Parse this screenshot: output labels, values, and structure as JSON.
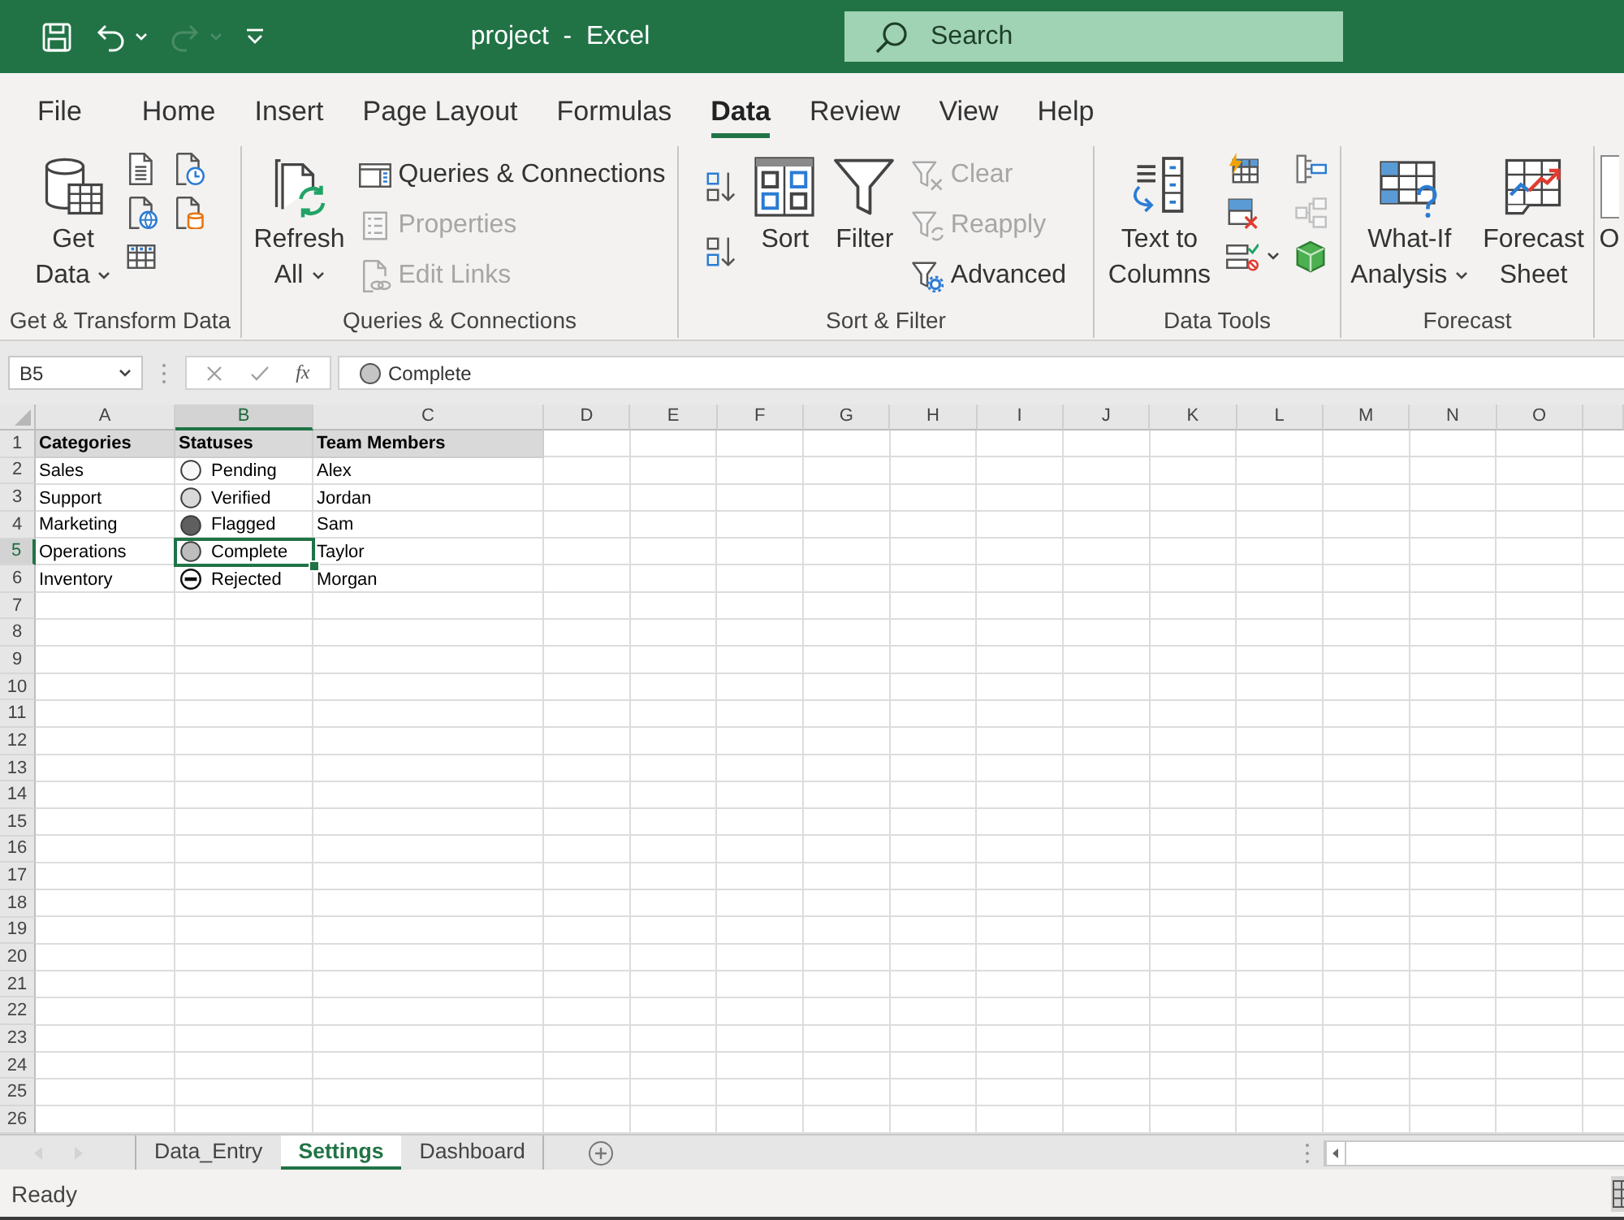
{
  "title_bar": {
    "quick_access": [
      {
        "disabled": false,
        "dropdown": false
      },
      {
        "disabled": false,
        "dropdown": true
      },
      {
        "disabled": true,
        "dropdown": true
      },
      {
        "disabled": false,
        "dropdown": false
      }
    ],
    "title": "project  -  Excel",
    "search": {
      "placeholder": "Search"
    }
  },
  "ribbon": {
    "tabs": [
      {
        "label": "File",
        "selected": false
      },
      {
        "label": "Home",
        "selected": false
      },
      {
        "label": "Insert",
        "selected": false
      },
      {
        "label": "Page Layout",
        "selected": false
      },
      {
        "label": "Formulas",
        "selected": false
      },
      {
        "label": "Data",
        "selected": true
      },
      {
        "label": "Review",
        "selected": false
      },
      {
        "label": "View",
        "selected": false
      },
      {
        "label": "Help",
        "selected": false
      }
    ],
    "groups": [
      {
        "label": "Get & Transform Data",
        "items": [
          {
            "kind": "large",
            "label": "Get\nData",
            "dropdown": true,
            "disabled": false
          },
          {
            "kind": "icon",
            "dropdown": false,
            "disabled": false
          },
          {
            "kind": "icon",
            "dropdown": false,
            "disabled": false
          },
          {
            "kind": "icon",
            "dropdown": false,
            "disabled": false
          },
          {
            "kind": "icon",
            "dropdown": false,
            "disabled": false
          },
          {
            "kind": "icon",
            "dropdown": false,
            "disabled": false
          }
        ]
      },
      {
        "label": "Queries & Connections",
        "items": [
          {
            "kind": "large",
            "label": "Refresh\nAll",
            "dropdown": true,
            "disabled": false
          },
          {
            "kind": "small",
            "label": "Queries & Connections",
            "dropdown": false,
            "disabled": false
          },
          {
            "kind": "small",
            "label": "Properties",
            "dropdown": false,
            "disabled": true
          },
          {
            "kind": "small",
            "label": "Edit Links",
            "dropdown": false,
            "disabled": true
          }
        ]
      },
      {
        "label": "Sort & Filter",
        "items": [
          {
            "kind": "icon",
            "dropdown": false,
            "disabled": false
          },
          {
            "kind": "icon",
            "dropdown": false,
            "disabled": false
          },
          {
            "kind": "large",
            "label": "Sort",
            "dropdown": false,
            "disabled": false
          },
          {
            "kind": "large",
            "label": "Filter",
            "dropdown": false,
            "disabled": false
          },
          {
            "kind": "small",
            "label": "Clear",
            "dropdown": false,
            "disabled": true
          },
          {
            "kind": "small",
            "label": "Reapply",
            "dropdown": false,
            "disabled": true
          },
          {
            "kind": "small",
            "label": "Advanced",
            "dropdown": false,
            "disabled": false
          }
        ]
      },
      {
        "label": "Data Tools",
        "items": [
          {
            "kind": "large",
            "label": "Text to\nColumns",
            "dropdown": false,
            "disabled": false
          },
          {
            "kind": "icon",
            "dropdown": false,
            "disabled": false
          },
          {
            "kind": "icon",
            "dropdown": false,
            "disabled": false
          },
          {
            "kind": "icon",
            "dropdown": true,
            "disabled": false
          },
          {
            "kind": "icon",
            "dropdown": false,
            "disabled": false
          },
          {
            "kind": "icon",
            "dropdown": false,
            "disabled": true
          },
          {
            "kind": "icon",
            "dropdown": false,
            "disabled": false
          }
        ]
      },
      {
        "label": "Forecast",
        "items": [
          {
            "kind": "large",
            "label": "What-If\nAnalysis",
            "dropdown": true,
            "disabled": false
          },
          {
            "kind": "large",
            "label": "Forecast\nSheet",
            "dropdown": false,
            "disabled": false
          }
        ]
      },
      {
        "items": [
          {
            "kind": "large",
            "label": "O",
            "dropdown": false,
            "disabled": false
          }
        ]
      }
    ]
  },
  "formula_bar": {
    "name_box": "B5",
    "function_label": "fx",
    "value": "Complete"
  },
  "sheet": {
    "columns": [
      {
        "label": "A",
        "selected": false
      },
      {
        "label": "B",
        "selected": true
      },
      {
        "label": "C",
        "selected": false
      },
      {
        "label": "D",
        "selected": false
      },
      {
        "label": "E",
        "selected": false
      },
      {
        "label": "F",
        "selected": false
      },
      {
        "label": "G",
        "selected": false
      },
      {
        "label": "H",
        "selected": false
      },
      {
        "label": "I",
        "selected": false
      },
      {
        "label": "J",
        "selected": false
      },
      {
        "label": "K",
        "selected": false
      },
      {
        "label": "L",
        "selected": false
      },
      {
        "label": "M",
        "selected": false
      },
      {
        "label": "N",
        "selected": false
      },
      {
        "label": "O",
        "selected": false
      }
    ],
    "rows": [
      {
        "number": "1",
        "selected": false,
        "kind": "header",
        "cells": [
          "Categories",
          "Statuses",
          "Team Members"
        ]
      },
      {
        "number": "2",
        "selected": false,
        "kind": "data",
        "category": "Sales",
        "status": {
          "kind": "circle",
          "color": "#f7f7f7",
          "text": "Pending"
        },
        "member": "Alex"
      },
      {
        "number": "3",
        "selected": false,
        "kind": "data",
        "category": "Support",
        "status": {
          "kind": "circle",
          "color": "#d9d9d9",
          "text": "Verified"
        },
        "member": "Jordan"
      },
      {
        "number": "4",
        "selected": false,
        "kind": "data",
        "category": "Marketing",
        "status": {
          "kind": "circle",
          "color": "#5f5f5f",
          "text": "Flagged"
        },
        "member": "Sam"
      },
      {
        "number": "5",
        "selected": true,
        "kind": "data",
        "category": "Operations",
        "status": {
          "kind": "circle",
          "color": "#bdbdbd",
          "text": "Complete"
        },
        "member": "Taylor"
      },
      {
        "number": "6",
        "selected": false,
        "kind": "data",
        "category": "Inventory",
        "status": {
          "kind": "minus",
          "text": "Rejected"
        },
        "member": "Morgan"
      },
      {
        "number": "7",
        "selected": false,
        "kind": "blank"
      },
      {
        "number": "8",
        "selected": false,
        "kind": "blank"
      },
      {
        "number": "9",
        "selected": false,
        "kind": "blank"
      },
      {
        "number": "10",
        "selected": false,
        "kind": "blank"
      },
      {
        "number": "11",
        "selected": false,
        "kind": "blank"
      },
      {
        "number": "12",
        "selected": false,
        "kind": "blank"
      },
      {
        "number": "13",
        "selected": false,
        "kind": "blank"
      },
      {
        "number": "14",
        "selected": false,
        "kind": "blank"
      },
      {
        "number": "15",
        "selected": false,
        "kind": "blank"
      },
      {
        "number": "16",
        "selected": false,
        "kind": "blank"
      },
      {
        "number": "17",
        "selected": false,
        "kind": "blank"
      },
      {
        "number": "18",
        "selected": false,
        "kind": "blank"
      },
      {
        "number": "19",
        "selected": false,
        "kind": "blank"
      },
      {
        "number": "20",
        "selected": false,
        "kind": "blank"
      },
      {
        "number": "21",
        "selected": false,
        "kind": "blank"
      },
      {
        "number": "22",
        "selected": false,
        "kind": "blank"
      },
      {
        "number": "23",
        "selected": false,
        "kind": "blank"
      },
      {
        "number": "24",
        "selected": false,
        "kind": "blank"
      },
      {
        "number": "25",
        "selected": false,
        "kind": "blank"
      },
      {
        "number": "26",
        "selected": false,
        "kind": "blank"
      }
    ]
  },
  "sheet_tabs": [
    {
      "label": "Data_Entry",
      "selected": false
    },
    {
      "label": "Settings",
      "selected": true
    },
    {
      "label": "Dashboard",
      "selected": false
    }
  ],
  "status_bar": {
    "text": "Ready"
  }
}
